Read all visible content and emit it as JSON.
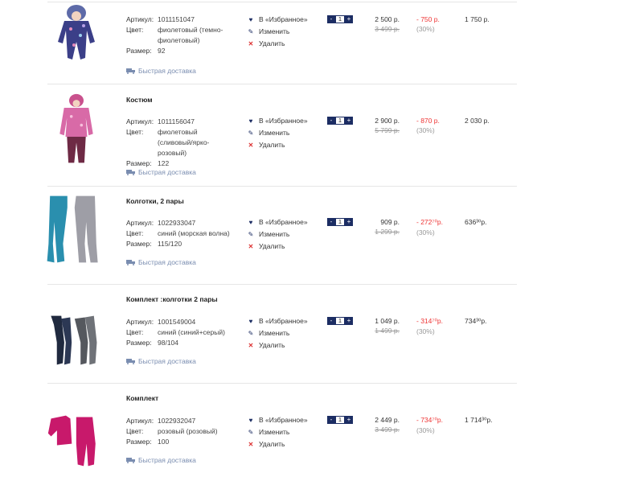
{
  "labels": {
    "article": "Артикул:",
    "color": "Цвет:",
    "size": "Размер:",
    "favorite": "В «Избранное»",
    "edit": "Изменить",
    "delete": "Удалить",
    "delivery": "Быстрая доставка"
  },
  "items": [
    {
      "title": "",
      "article": "1011151047",
      "color": "фиолетовый (темно-фиолетовый)",
      "size": "92",
      "qty": "1",
      "price": "2 500 р.",
      "old_price": "3 499 р.",
      "discount": "- 750 р.",
      "discount_pct": "(30%)",
      "total": "1 750 р."
    },
    {
      "title": "Костюм",
      "article": "1011156047",
      "color": "фиолетовый (сливовый/ярко-розовый)",
      "size": "122",
      "qty": "1",
      "price": "2 900 р.",
      "old_price": "5 799 р.",
      "discount": "- 870 р.",
      "discount_pct": "(30%)",
      "total": "2 030 р."
    },
    {
      "title": "Колготки, 2 пары",
      "article": "1022933047",
      "color": "синий (морская волна)",
      "size": "115/120",
      "qty": "1",
      "price": "909 р.",
      "old_price": "1 299 р.",
      "discount": "- 272⁷⁰р.",
      "discount_pct": "(30%)",
      "total": "636³⁰р."
    },
    {
      "title": "Комплект :колготки 2 пары",
      "article": "1001549004",
      "color": "синий (синий+серый)",
      "size": "98/104",
      "qty": "1",
      "price": "1 049 р.",
      "old_price": "1 499 р.",
      "discount": "- 314⁷⁰р.",
      "discount_pct": "(30%)",
      "total": "734³⁰р."
    },
    {
      "title": "Комплект",
      "article": "1022932047",
      "color": "розовый (розовый)",
      "size": "100",
      "qty": "1",
      "price": "2 449 р.",
      "old_price": "3 499 р.",
      "discount": "- 734⁷⁰р.",
      "discount_pct": "(30%)",
      "total": "1 714³⁰р."
    }
  ],
  "qty_controls": {
    "minus": "-",
    "plus": "+"
  },
  "icons": [
    "product-image",
    "heart-icon",
    "pencil-icon",
    "close-icon",
    "truck-icon"
  ],
  "colors": {
    "accent": "#1c2d63",
    "discount": "#e33333",
    "delete": "#dd3333",
    "delivery": "#7a8db0"
  }
}
